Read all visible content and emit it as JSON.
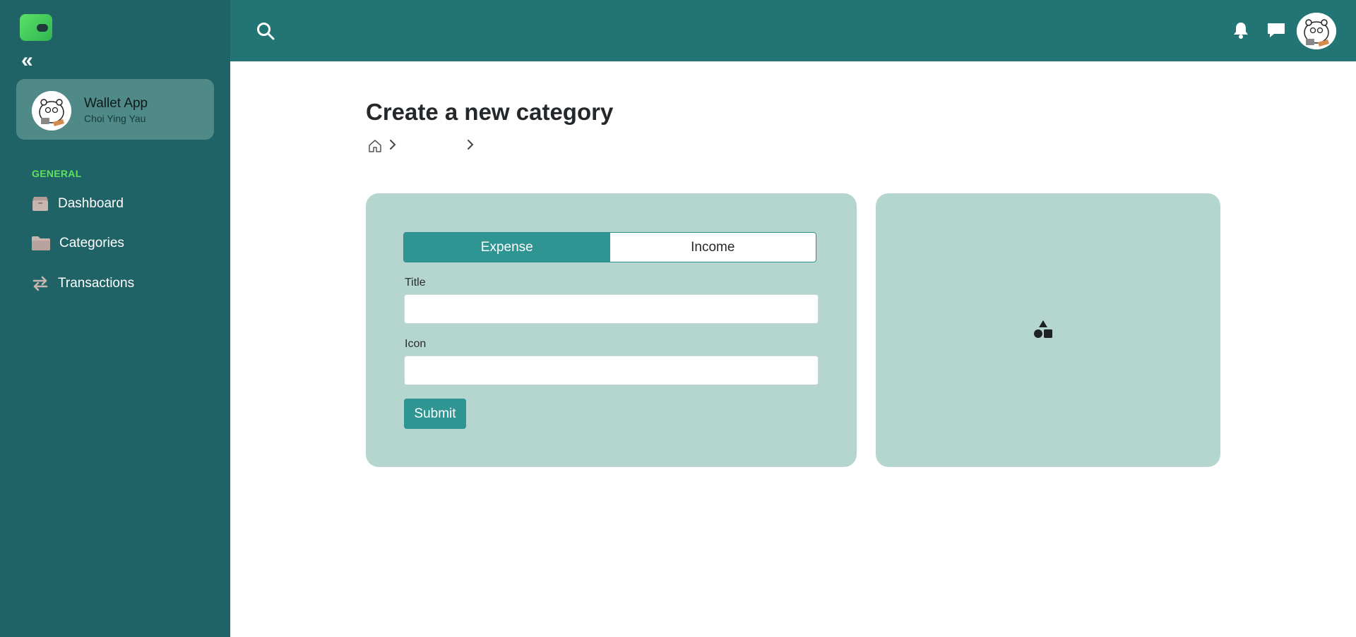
{
  "app": {
    "name": "Wallet App",
    "user": "Choi Ying Yau"
  },
  "sidebar": {
    "section_label": "GENERAL",
    "items": [
      {
        "label": "Dashboard",
        "icon": "box-icon"
      },
      {
        "label": "Categories",
        "icon": "folder-icon"
      },
      {
        "label": "Transactions",
        "icon": "arrows-exchange-icon"
      }
    ]
  },
  "topbar": {
    "icons": [
      "search-icon",
      "bell-icon",
      "chat-icon",
      "avatar"
    ]
  },
  "page": {
    "title": "Create a new category",
    "breadcrumb": [
      "",
      ""
    ]
  },
  "form": {
    "toggle": {
      "options": [
        "Expense",
        "Income"
      ],
      "selected": "Expense"
    },
    "title_label": "Title",
    "title_value": "",
    "icon_label": "Icon",
    "icon_value": "",
    "submit_label": "Submit"
  },
  "preview": {
    "icon": "shapes-icon"
  },
  "colors": {
    "sidebar": "#1f6366",
    "topbar": "#237575",
    "card": "#b5d6ce",
    "accent": "#2e9592",
    "section_label": "#5ee05e"
  }
}
